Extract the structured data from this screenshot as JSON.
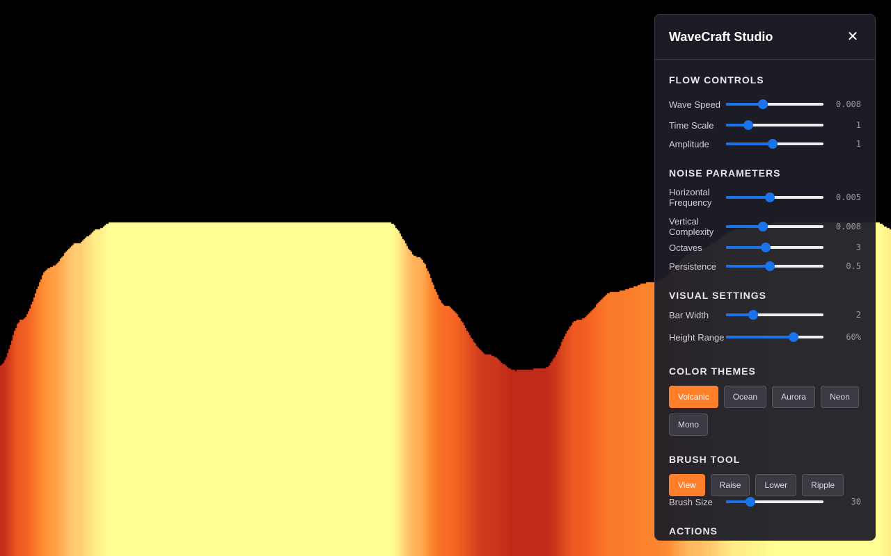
{
  "colors": {
    "accent": "#ff7f2a",
    "slider": "#1a73e8",
    "panel_bg": "#1e1e28"
  },
  "panel": {
    "title": "WaveCraft Studio",
    "close_icon": "✕"
  },
  "flow_controls": {
    "title": "FLOW CONTROLS",
    "items": [
      {
        "label": "Wave Speed",
        "value": "0.008",
        "level": 0.38
      },
      {
        "label": "Time Scale",
        "value": "1",
        "level": 0.23
      },
      {
        "label": "Amplitude",
        "value": "1",
        "level": 0.48
      }
    ]
  },
  "noise_parameters": {
    "title": "NOISE PARAMETERS",
    "items": [
      {
        "label": "Horizontal Frequency",
        "value": "0.005",
        "level": 0.45
      },
      {
        "label": "Vertical Complexity",
        "value": "0.008",
        "level": 0.38
      },
      {
        "label": "Octaves",
        "value": "3",
        "level": 0.41
      },
      {
        "label": "Persistence",
        "value": "0.5",
        "level": 0.45
      }
    ]
  },
  "visual_settings": {
    "title": "VISUAL SETTINGS",
    "items": [
      {
        "label": "Bar Width",
        "value": "2",
        "level": 0.28
      },
      {
        "label": "Height Range",
        "value": "60%",
        "level": 0.69
      }
    ]
  },
  "color_themes": {
    "title": "COLOR THEMES",
    "options": [
      "Volcanic",
      "Ocean",
      "Aurora",
      "Neon",
      "Mono"
    ],
    "selected": "Volcanic"
  },
  "brush_tool": {
    "title": "BRUSH TOOL",
    "options": [
      "View",
      "Raise",
      "Lower",
      "Ripple"
    ],
    "selected": "View",
    "size_label": "Brush Size",
    "size_value": "30",
    "size_level": 0.25
  },
  "actions": {
    "title": "ACTIONS"
  }
}
